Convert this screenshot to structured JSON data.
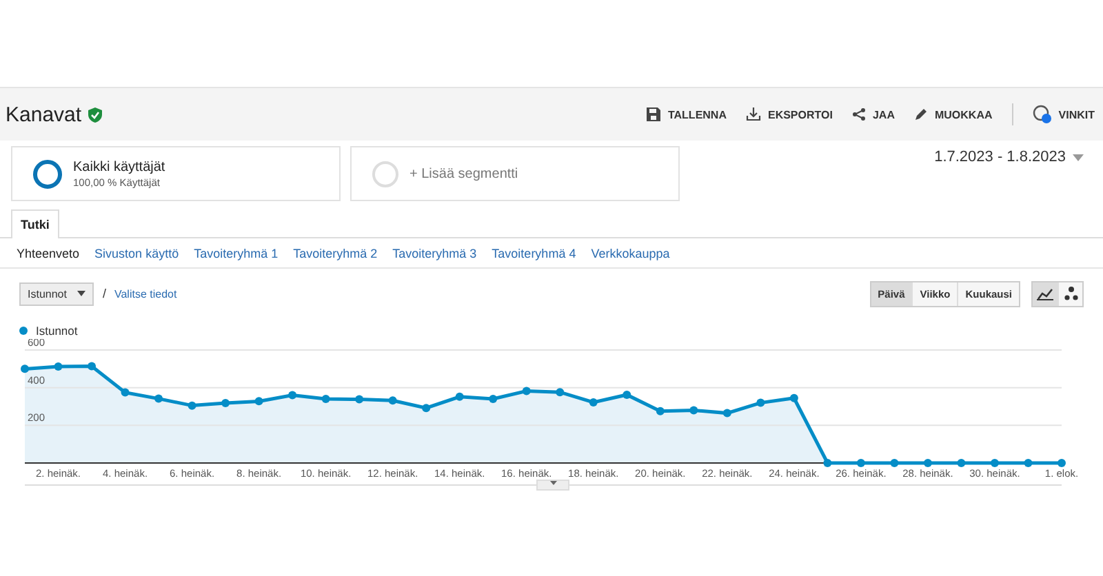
{
  "header": {
    "title": "Kanavat",
    "actions": [
      {
        "kind": "save",
        "label": "TALLENNA"
      },
      {
        "kind": "export",
        "label": "EKSPORTOI"
      },
      {
        "kind": "share",
        "label": "JAA"
      },
      {
        "kind": "edit",
        "label": "MUOKKAA"
      },
      {
        "kind": "tips",
        "label": "VINKIT"
      }
    ]
  },
  "segments": [
    {
      "kind": "active",
      "name": "Kaikki käyttäjät",
      "detail": "100,00 % Käyttäjät"
    },
    {
      "kind": "add",
      "name": "+ Lisää segmentti"
    }
  ],
  "date_range": "1.7.2023 - 1.8.2023",
  "tabs": [
    {
      "label": "Tutki",
      "selected": true
    }
  ],
  "subtabs": [
    {
      "label": "Yhteenveto",
      "selected": true
    },
    {
      "label": "Sivuston käyttö",
      "selected": false
    },
    {
      "label": "Tavoiteryhmä 1",
      "selected": false
    },
    {
      "label": "Tavoiteryhmä 2",
      "selected": false
    },
    {
      "label": "Tavoiteryhmä 3",
      "selected": false
    },
    {
      "label": "Tavoiteryhmä 4",
      "selected": false
    },
    {
      "label": "Verkkokauppa",
      "selected": false
    }
  ],
  "metric": {
    "value": "Istunnot",
    "separator": "/",
    "link": "Valitse tiedot"
  },
  "periods": [
    {
      "label": "Päivä",
      "selected": true
    },
    {
      "label": "Viikko",
      "selected": false
    },
    {
      "label": "Kuukausi",
      "selected": false
    }
  ],
  "chart_types": [
    {
      "kind": "line",
      "selected": true
    },
    {
      "kind": "motion",
      "selected": false
    }
  ],
  "chart_data": {
    "type": "area",
    "x": [
      "2023-07-01",
      "2023-07-02",
      "2023-07-03",
      "2023-07-04",
      "2023-07-05",
      "2023-07-06",
      "2023-07-07",
      "2023-07-08",
      "2023-07-09",
      "2023-07-10",
      "2023-07-11",
      "2023-07-12",
      "2023-07-13",
      "2023-07-14",
      "2023-07-15",
      "2023-07-16",
      "2023-07-17",
      "2023-07-18",
      "2023-07-19",
      "2023-07-20",
      "2023-07-21",
      "2023-07-22",
      "2023-07-23",
      "2023-07-24",
      "2023-07-25",
      "2023-07-26",
      "2023-07-27",
      "2023-07-28",
      "2023-07-29",
      "2023-07-30",
      "2023-07-31",
      "2023-08-01"
    ],
    "series": [
      {
        "name": "Istunnot",
        "color": "#058dc7",
        "values": [
          500,
          512,
          514,
          375,
          342,
          305,
          318,
          328,
          360,
          340,
          338,
          332,
          292,
          352,
          340,
          382,
          376,
          322,
          362,
          275,
          280,
          265,
          320,
          345,
          0,
          0,
          0,
          0,
          0,
          0,
          0,
          0
        ]
      }
    ],
    "xlim": [
      "2023-07-01",
      "2023-08-01"
    ],
    "ylim": [
      0,
      600
    ],
    "yticks": [
      200,
      400,
      600
    ],
    "xticks": [
      {
        "value": "2023-07-02",
        "label": "2. heinäk."
      },
      {
        "value": "2023-07-04",
        "label": "4. heinäk."
      },
      {
        "value": "2023-07-06",
        "label": "6. heinäk."
      },
      {
        "value": "2023-07-08",
        "label": "8. heinäk."
      },
      {
        "value": "2023-07-10",
        "label": "10. heinäk."
      },
      {
        "value": "2023-07-12",
        "label": "12. heinäk."
      },
      {
        "value": "2023-07-14",
        "label": "14. heinäk."
      },
      {
        "value": "2023-07-16",
        "label": "16. heinäk."
      },
      {
        "value": "2023-07-18",
        "label": "18. heinäk."
      },
      {
        "value": "2023-07-20",
        "label": "20. heinäk."
      },
      {
        "value": "2023-07-22",
        "label": "22. heinäk."
      },
      {
        "value": "2023-07-24",
        "label": "24. heinäk."
      },
      {
        "value": "2023-07-26",
        "label": "26. heinäk."
      },
      {
        "value": "2023-07-28",
        "label": "28. heinäk."
      },
      {
        "value": "2023-07-30",
        "label": "30. heinäk."
      },
      {
        "value": "2023-08-01",
        "label": "1. elok."
      }
    ]
  }
}
